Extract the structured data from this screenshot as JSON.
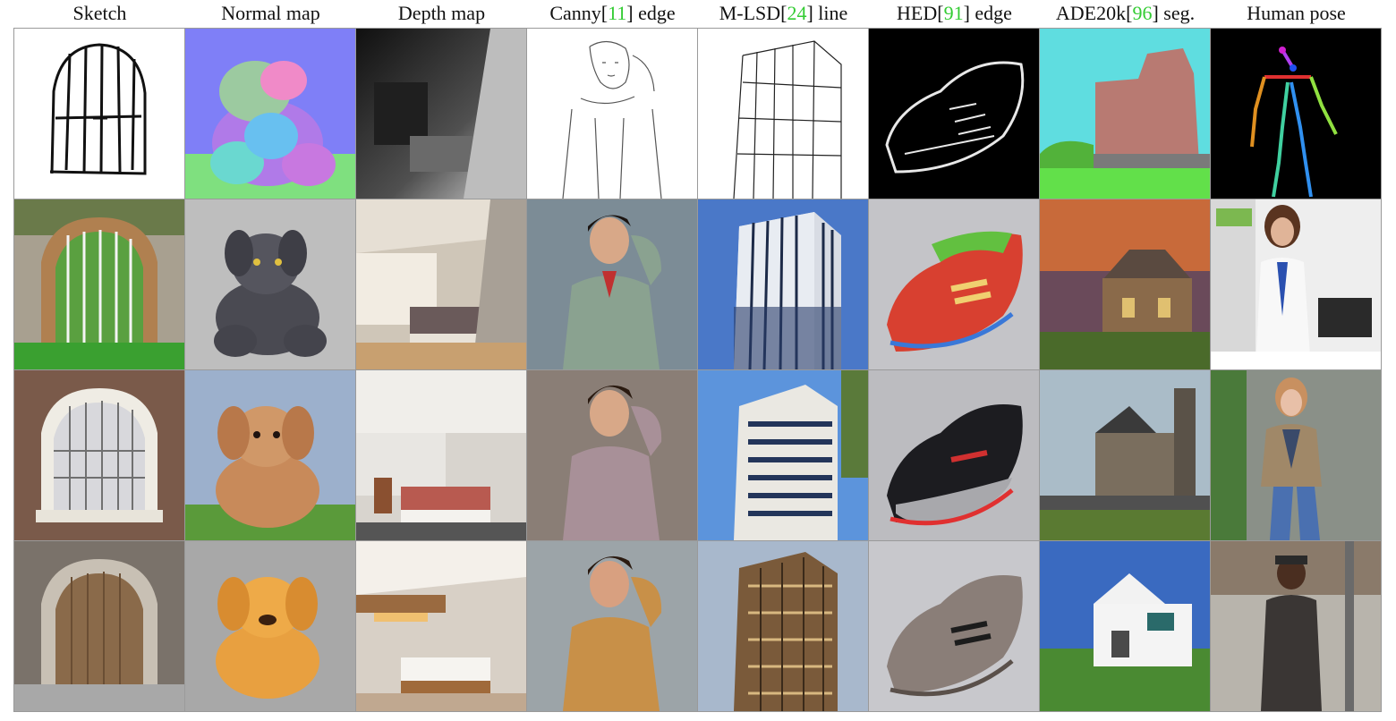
{
  "columns": [
    {
      "label": "Sketch"
    },
    {
      "label": "Normal map"
    },
    {
      "label": "Depth map"
    },
    {
      "pre": "Canny[",
      "ref": "11",
      "post": "] edge"
    },
    {
      "pre": "M-LSD[",
      "ref": "24",
      "post": "] line"
    },
    {
      "pre": "HED[",
      "ref": "91",
      "post": "] edge"
    },
    {
      "pre": "ADE20k[",
      "ref": "96",
      "post": "] seg."
    },
    {
      "label": "Human pose"
    }
  ],
  "colors": {
    "citation": "#33cc33"
  }
}
